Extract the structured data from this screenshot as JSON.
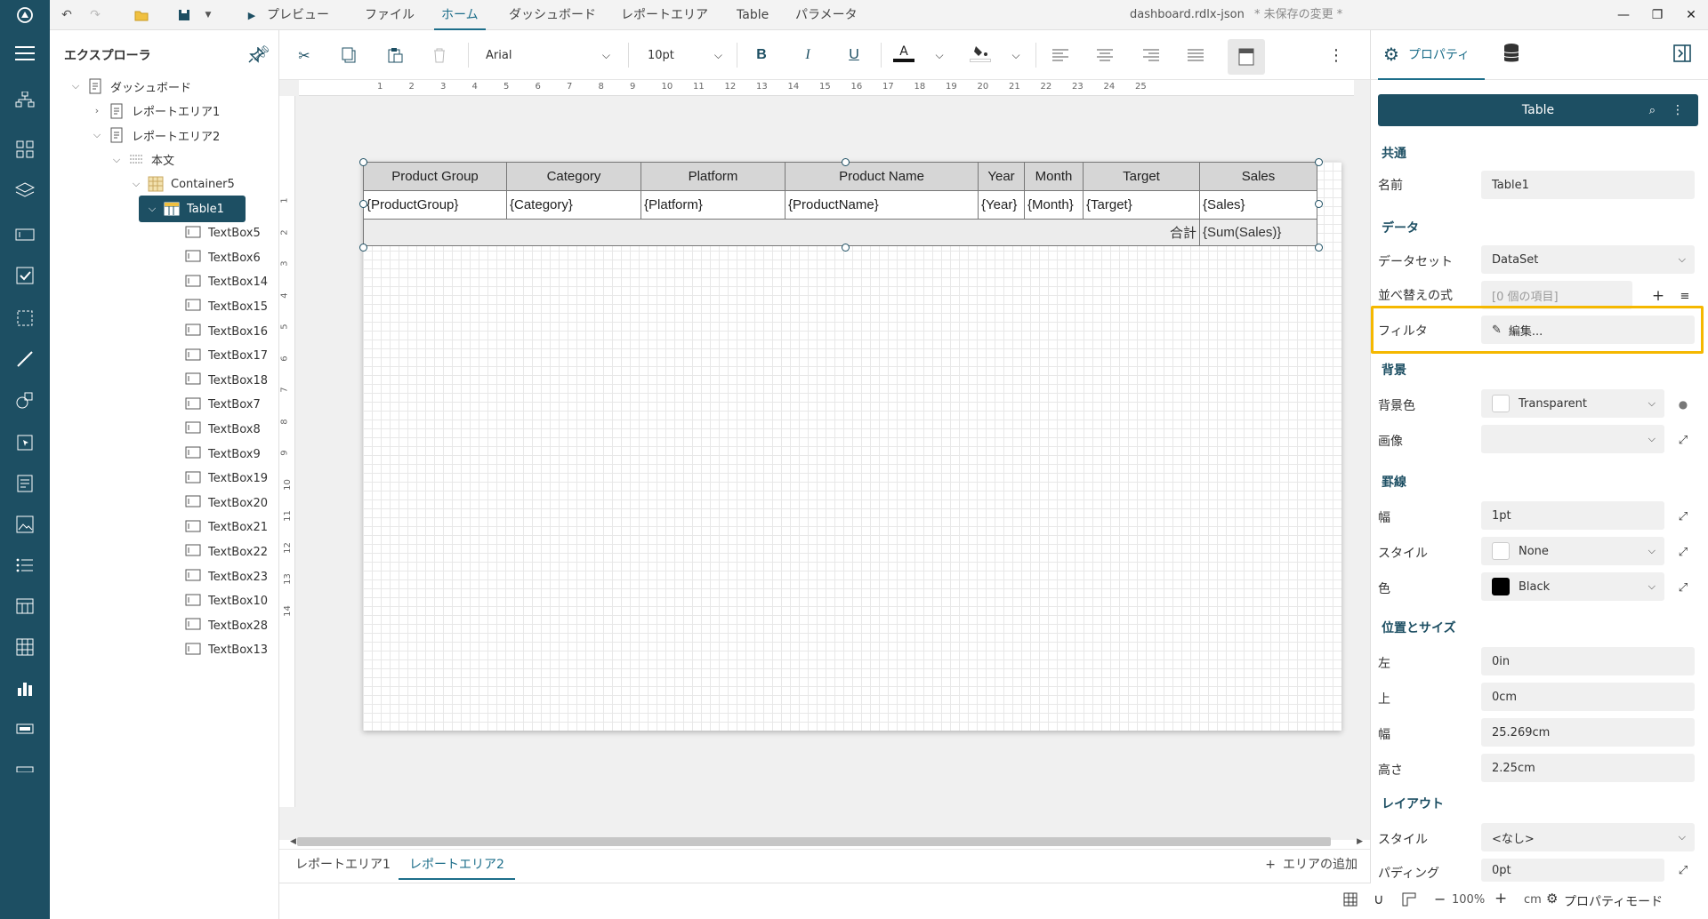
{
  "menubar": {
    "items": [
      "プレビュー",
      "ファイル",
      "ホーム",
      "ダッシュボード",
      "レポートエリア",
      "Table",
      "パラメータ"
    ],
    "active": "ホーム",
    "doc_title": "dashboard.rdlx-json",
    "unsaved": "* 未保存の変更 *"
  },
  "explorer": {
    "title": "エクスプローラ",
    "tree": [
      {
        "label": "ダッシュボード"
      },
      {
        "label": "レポートエリア1"
      },
      {
        "label": "レポートエリア2"
      },
      {
        "label": "本文"
      },
      {
        "label": "Container5"
      },
      {
        "label": "Table1"
      },
      {
        "label": "TextBox5"
      },
      {
        "label": "TextBox6"
      },
      {
        "label": "TextBox14"
      },
      {
        "label": "TextBox15"
      },
      {
        "label": "TextBox16"
      },
      {
        "label": "TextBox17"
      },
      {
        "label": "TextBox18"
      },
      {
        "label": "TextBox7"
      },
      {
        "label": "TextBox8"
      },
      {
        "label": "TextBox9"
      },
      {
        "label": "TextBox19"
      },
      {
        "label": "TextBox20"
      },
      {
        "label": "TextBox21"
      },
      {
        "label": "TextBox22"
      },
      {
        "label": "TextBox23"
      },
      {
        "label": "TextBox10"
      },
      {
        "label": "TextBox28"
      },
      {
        "label": "TextBox13"
      }
    ]
  },
  "toolbar": {
    "font": "Arial",
    "size": "10pt",
    "bold": "B",
    "italic": "I",
    "underline": "U",
    "font_color_letter": "A"
  },
  "ruler": {
    "h": [
      "1",
      "2",
      "3",
      "4",
      "5",
      "6",
      "7",
      "8",
      "9",
      "10",
      "11",
      "12",
      "13",
      "14",
      "15",
      "16",
      "17",
      "18",
      "19",
      "20",
      "21",
      "22",
      "23",
      "24",
      "25"
    ],
    "v": [
      "1",
      "2",
      "3",
      "4",
      "5",
      "6",
      "7",
      "8",
      "9",
      "10",
      "11",
      "12",
      "13",
      "14"
    ]
  },
  "table": {
    "headers": [
      "Product Group",
      "Category",
      "Platform",
      "Product Name",
      "Year",
      "Month",
      "Target",
      "Sales"
    ],
    "details": [
      "{ProductGroup}",
      "{Category}",
      "{Platform}",
      "{ProductName}",
      "{Year}",
      "{Month}",
      "{Target}",
      "{Sales}"
    ],
    "total_label": "合計",
    "total_value": "{Sum(Sales)}"
  },
  "bottom": {
    "tabs": [
      "レポートエリア1",
      "レポートエリア2"
    ],
    "active": "レポートエリア2",
    "add": "エリアの追加"
  },
  "status": {
    "zoom": "100%",
    "unit": "cm",
    "mode": "プロパティモード"
  },
  "props": {
    "tab_properties": "プロパティ",
    "title": "Table",
    "sections": {
      "common": "共通",
      "data": "データ",
      "background": "背景",
      "border": "罫線",
      "position": "位置とサイズ",
      "layout": "レイアウト"
    },
    "fields": {
      "name_label": "名前",
      "name_value": "Table1",
      "dataset_label": "データセット",
      "dataset_value": "DataSet",
      "sort_label": "並べ替えの式",
      "sort_value": "[0 個の項目]",
      "filter_label": "フィルタ",
      "filter_value": "編集...",
      "bgcolor_label": "背景色",
      "bgcolor_value": "Transparent",
      "image_label": "画像",
      "image_value": "",
      "bwidth_label": "幅",
      "bwidth_value": "1pt",
      "bstyle_label": "スタイル",
      "bstyle_value": "None",
      "bcolor_label": "色",
      "bcolor_value": "Black",
      "left_label": "左",
      "left_value": "0in",
      "top_label": "上",
      "top_value": "0cm",
      "width_label": "幅",
      "width_value": "25.269cm",
      "height_label": "高さ",
      "height_value": "2.25cm",
      "lstyle_label": "スタイル",
      "lstyle_value": "<なし>",
      "padding_label": "パディング",
      "padding_value": "0pt"
    }
  },
  "colors": {
    "brand": "#1d4f63",
    "accent": "#1d6e8a",
    "highlight": "#f5b800"
  }
}
